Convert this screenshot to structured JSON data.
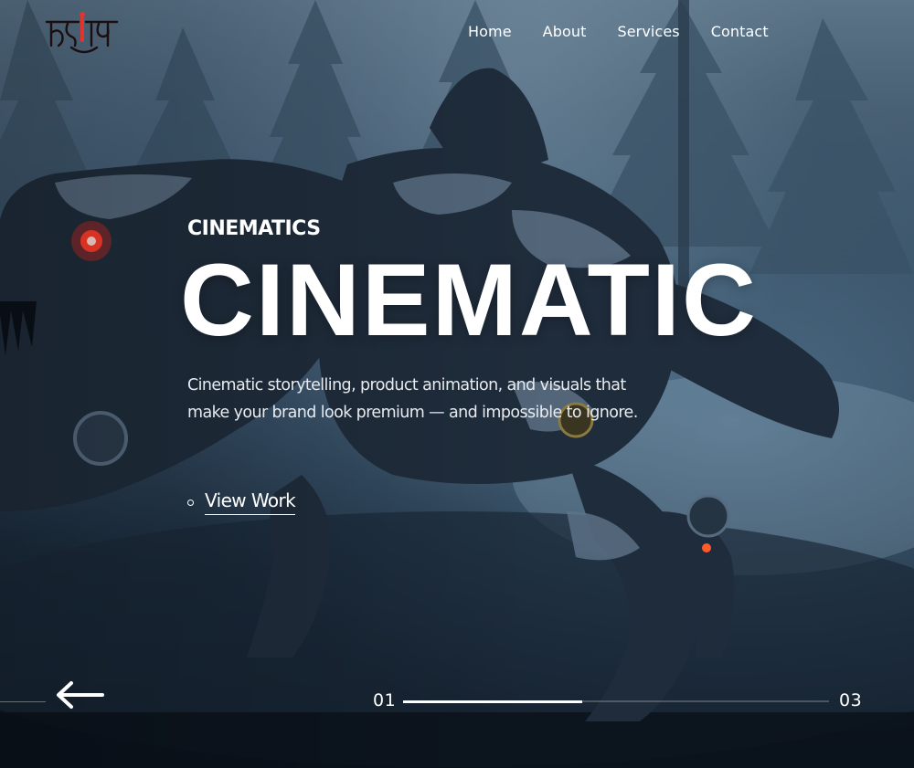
{
  "brand": {
    "logo_text": "Hriday",
    "accent_color": "#e0342c"
  },
  "nav": {
    "items": [
      {
        "label": "Home"
      },
      {
        "label": "About"
      },
      {
        "label": "Services"
      },
      {
        "label": "Contact"
      }
    ]
  },
  "hero": {
    "eyebrow": "CINEMATICS",
    "headline": "CINEMATIC",
    "description": "Cinematic storytelling, product animation, and visuals that make your brand look premium — and impossible to ignore.",
    "cta_label": "View Work"
  },
  "slider": {
    "current": "01",
    "total": "03",
    "progress": 0.42,
    "prev_icon": "arrow-left-icon"
  }
}
